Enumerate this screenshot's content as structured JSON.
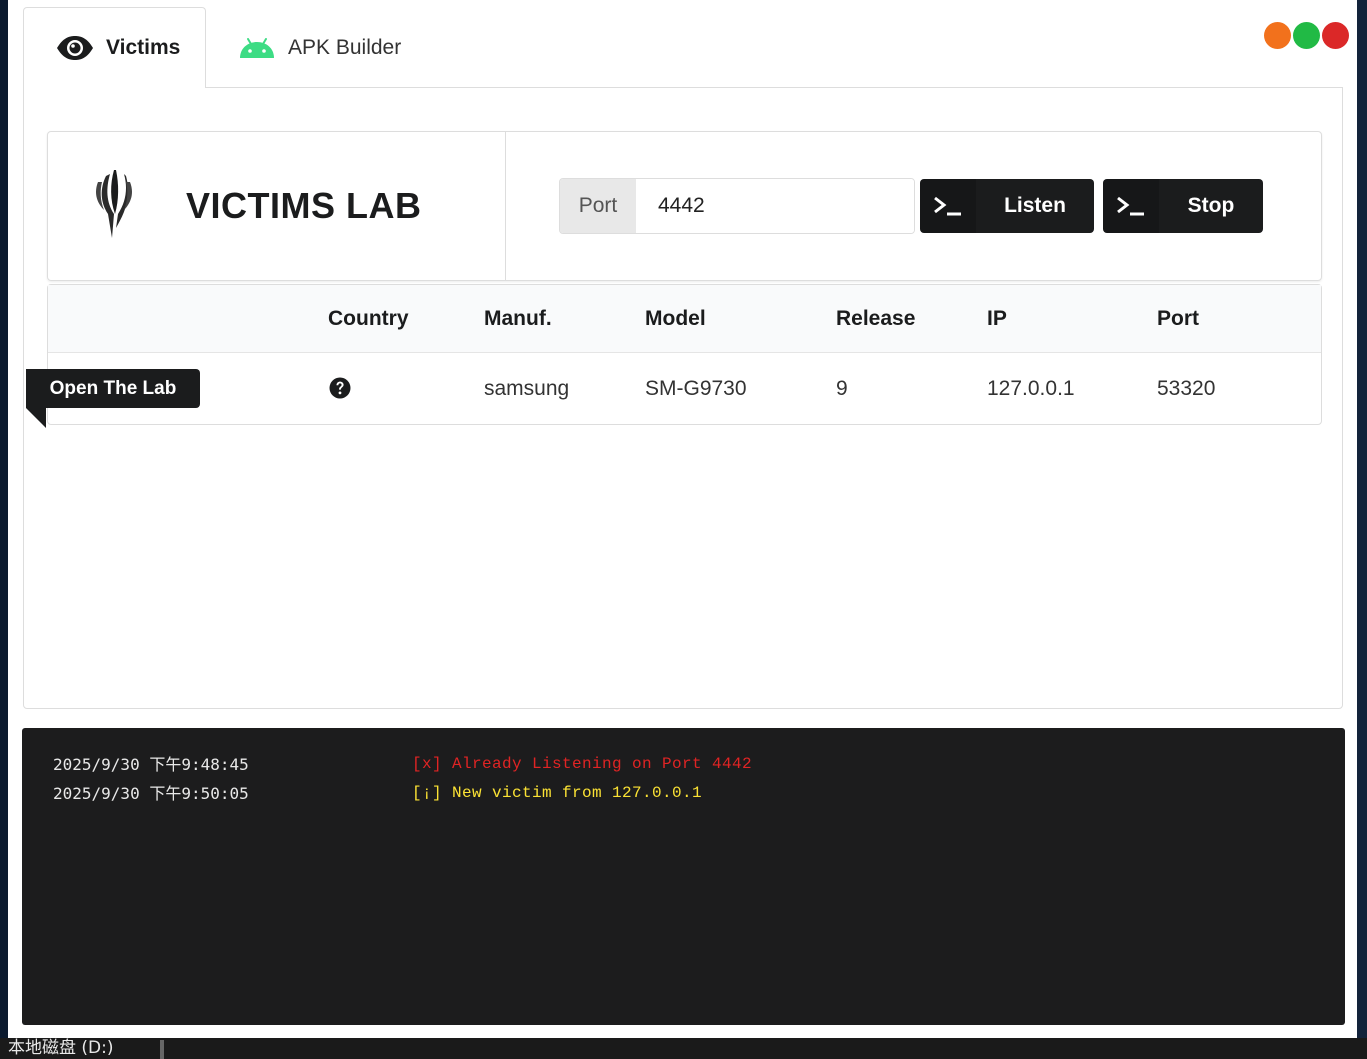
{
  "window": {
    "tabs": [
      {
        "label": "Victims",
        "icon": "eye-icon",
        "active": true
      },
      {
        "label": "APK Builder",
        "icon": "android-icon",
        "active": false
      }
    ],
    "window_controls": {
      "minimize_color": "#f2711c",
      "maximize_color": "#21ba45",
      "close_color": "#db2828"
    }
  },
  "header": {
    "title": "VICTIMS LAB",
    "logo_icon": "claw-logo-icon",
    "port_label": "Port",
    "port_value": "4442",
    "listen_label": "Listen",
    "stop_label": "Stop",
    "terminal_icon": "terminal-icon"
  },
  "table": {
    "columns": [
      "Country",
      "Manuf.",
      "Model",
      "Release",
      "IP",
      "Port"
    ],
    "rows": [
      {
        "action_label": "Open The Lab",
        "country_icon": "question-circle-icon",
        "manufacturer": "samsung",
        "model": "SM-G9730",
        "release": "9",
        "ip": "127.0.0.1",
        "port": "53320"
      }
    ]
  },
  "log": {
    "entries": [
      {
        "time": "2025/9/30 下午9:48:45",
        "message": "[x] Already Listening on Port 4442",
        "color": "#e02424"
      },
      {
        "time": "2025/9/30 下午9:50:05",
        "message": "[¡] New victim from 127.0.0.1",
        "color": "#fbe234"
      }
    ]
  },
  "taskbar": {
    "drive_label": "本地磁盘 (D:)"
  }
}
